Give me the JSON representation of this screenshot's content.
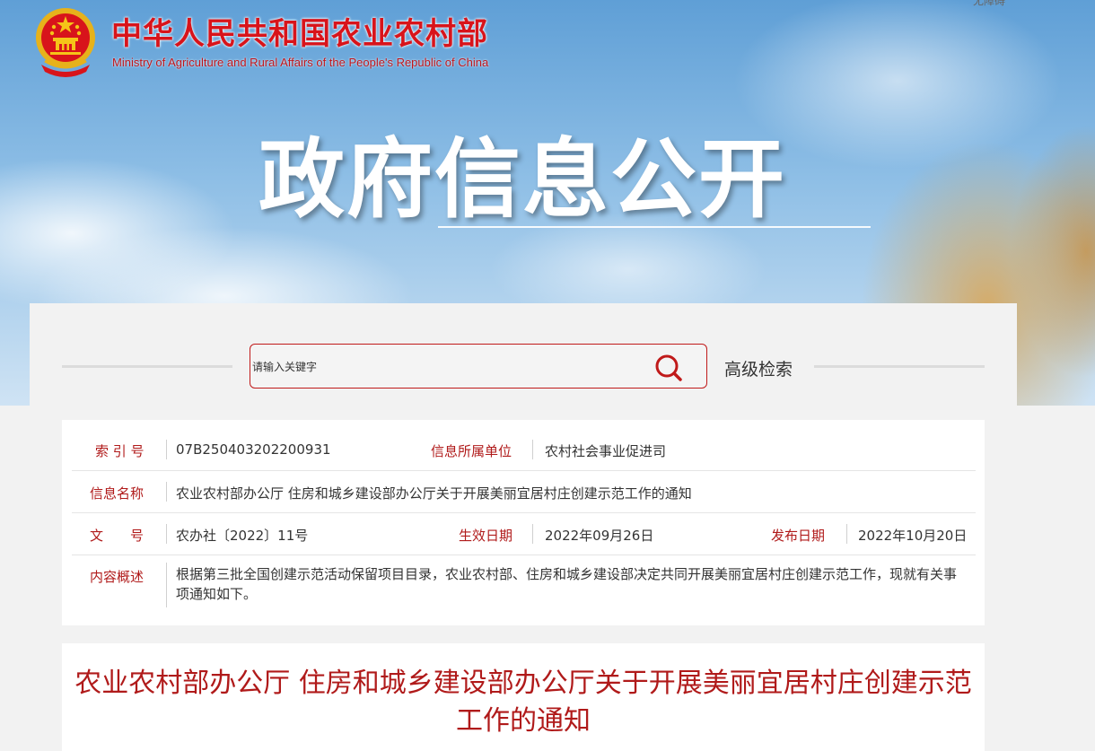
{
  "header": {
    "ministry_cn": "中华人民共和国农业农村部",
    "ministry_en": "Ministry of Agriculture and Rural Affairs of the People's Republic of China",
    "top_link": "无障碍",
    "hero_title": "政府信息公开"
  },
  "search": {
    "placeholder": "请输入关键字",
    "advanced_label": "高级检索"
  },
  "info": {
    "index_label": "索 引 号",
    "index_value": "07B250403202200931",
    "unit_label": "信息所属单位",
    "unit_value": "农村社会事业促进司",
    "name_label": "信息名称",
    "name_value": "农业农村部办公厅 住房和城乡建设部办公厅关于开展美丽宜居村庄创建示范工作的通知",
    "doc_label": "文　　号",
    "doc_value": "农办社〔2022〕11号",
    "effective_label": "生效日期",
    "effective_value": "2022年09月26日",
    "publish_label": "发布日期",
    "publish_value": "2022年10月20日",
    "summary_label": "内容概述",
    "summary_value": "根据第三批全国创建示范活动保留项目目录，农业农村部、住房和城乡建设部决定共同开展美丽宜居村庄创建示范工作，现就有关事项通知如下。"
  },
  "article": {
    "title": "农业农村部办公厅 住房和城乡建设部办公厅关于开展美丽宜居村庄创建示范工作的通知"
  },
  "colors": {
    "brand_red": "#d8141b",
    "label_red": "#b01a1a"
  },
  "icons": [
    "national-emblem-icon",
    "search-icon"
  ]
}
